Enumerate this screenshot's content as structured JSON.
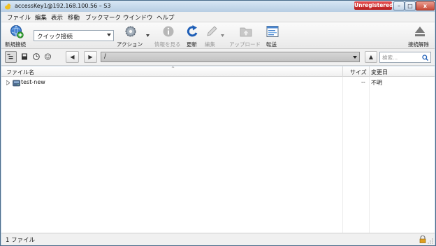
{
  "window": {
    "title": "accessKey1@192.168.100.56 – S3",
    "unregistered_label": "Unregistered",
    "minimize_label": "–",
    "maximize_label": "□",
    "close_label": "x"
  },
  "menu": [
    "ファイル",
    "編集",
    "表示",
    "移動",
    "ブックマーク",
    "ウインドウ",
    "ヘルプ"
  ],
  "toolbar": {
    "new_connection": "新規接続",
    "quick_connect": "クイック接続",
    "action": "アクション",
    "info": "情報を見る",
    "refresh": "更新",
    "edit": "編集",
    "upload": "アップロード",
    "transfer": "転送",
    "disconnect": "接続解除"
  },
  "nav": {
    "back": "◀",
    "forward": "▶",
    "path": "/",
    "up": "▲",
    "search_placeholder": "検索..."
  },
  "columns": {
    "name": "ファイル名",
    "size": "サイズ",
    "modified": "変更日"
  },
  "files": [
    {
      "name": "test-new",
      "size": "--",
      "modified": "不明"
    }
  ],
  "status": {
    "text": "1 ファイル"
  },
  "colors": {
    "accent": "#2d6cc0",
    "unregistered": "#c42727",
    "window_frame": "#c9dbec"
  }
}
